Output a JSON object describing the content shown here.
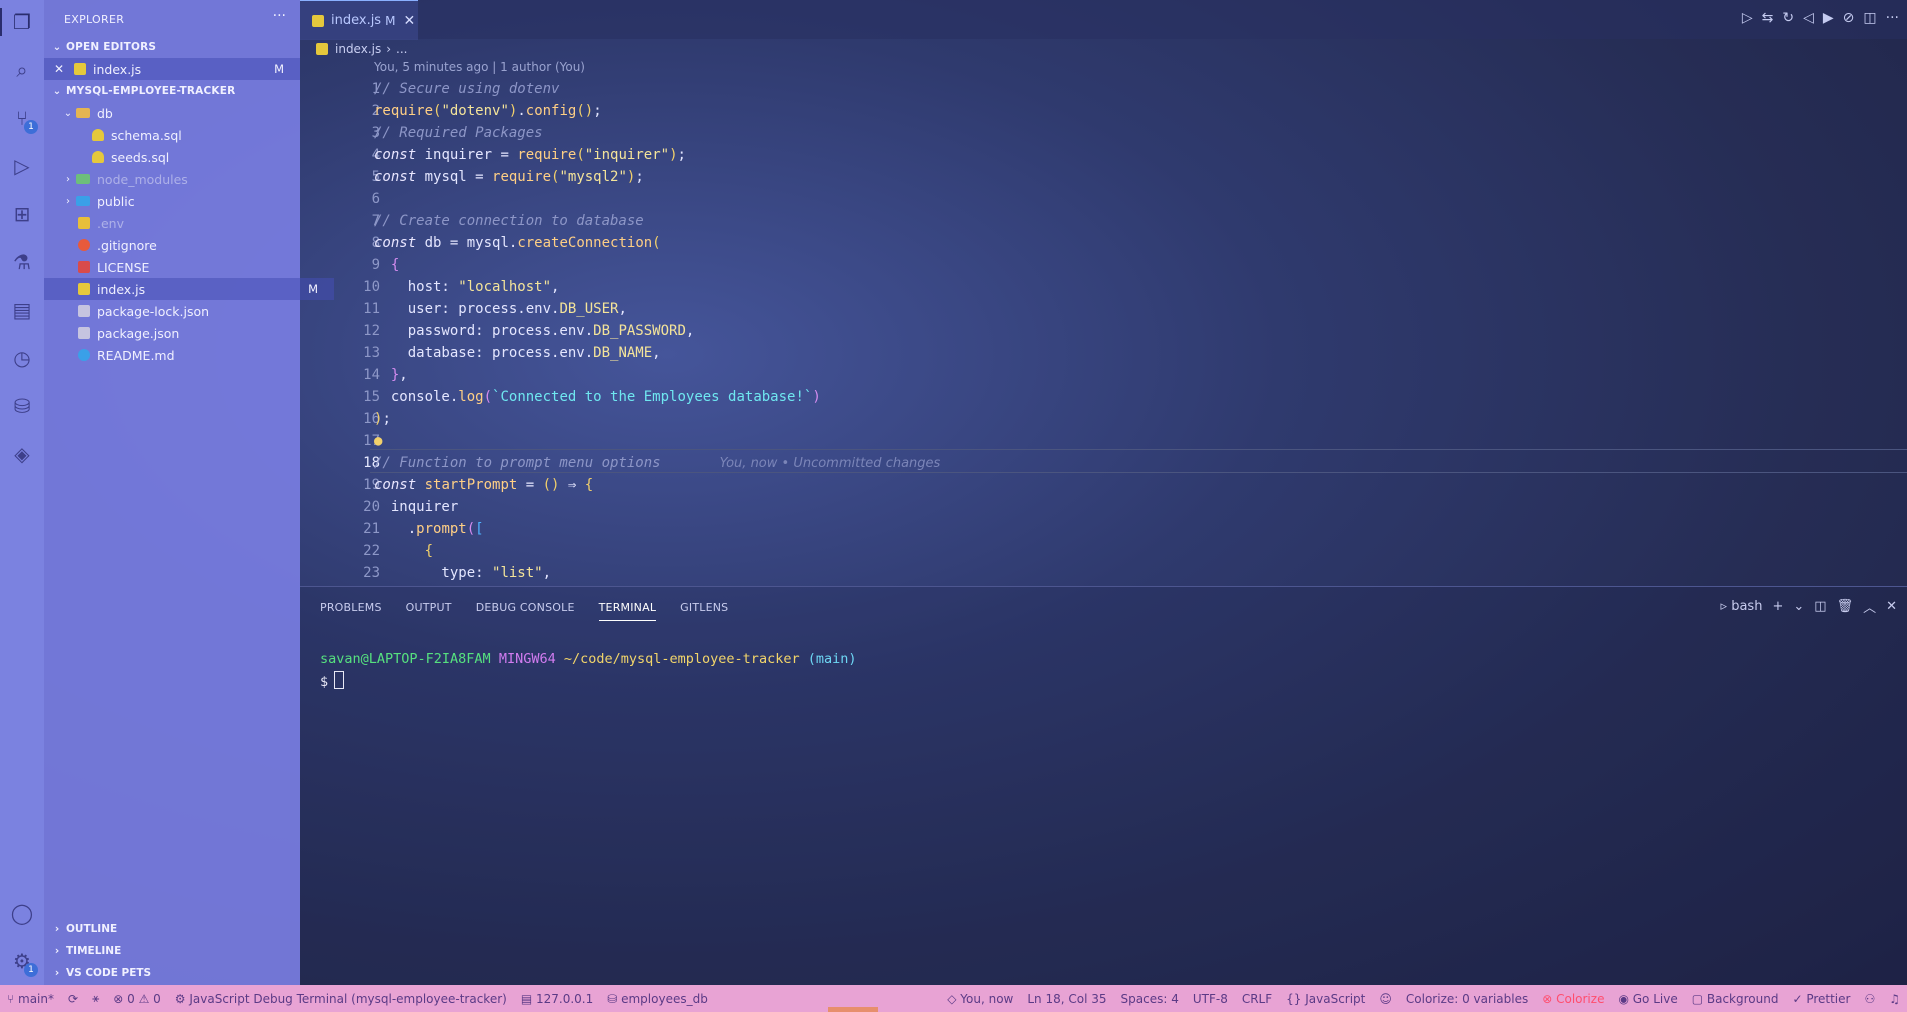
{
  "activity_bar": {
    "items": [
      {
        "name": "files-icon",
        "glyph": "❐"
      },
      {
        "name": "search-icon",
        "glyph": "⌕"
      },
      {
        "name": "source-control-icon",
        "glyph": "⑂",
        "badge": "1"
      },
      {
        "name": "run-debug-icon",
        "glyph": "▷"
      },
      {
        "name": "extensions-icon",
        "glyph": "⊞"
      },
      {
        "name": "testing-icon",
        "glyph": "⚗"
      },
      {
        "name": "notebook-icon",
        "glyph": "▤"
      },
      {
        "name": "git-graph-icon",
        "glyph": "◷"
      },
      {
        "name": "database-icon",
        "glyph": "⛁"
      },
      {
        "name": "layers-icon",
        "glyph": "◈"
      }
    ],
    "account_glyph": "◯",
    "settings_glyph": "⚙",
    "settings_badge": "1"
  },
  "sidebar": {
    "title": "EXPLORER",
    "more": "···",
    "open_editors": {
      "header": "OPEN EDITORS",
      "items": [
        {
          "close": "✕",
          "label": "index.js",
          "mark": "M"
        }
      ]
    },
    "project": {
      "header": "MYSQL-EMPLOYEE-TRACKER",
      "tree": [
        {
          "label": "db",
          "kind": "folder",
          "chevron": "⌄"
        },
        {
          "label": "schema.sql",
          "kind": "sql"
        },
        {
          "label": "seeds.sql",
          "kind": "sql"
        },
        {
          "label": "node_modules",
          "kind": "folder-g",
          "chevron": "›"
        },
        {
          "label": "public",
          "kind": "folder-b",
          "chevron": "›"
        },
        {
          "label": ".env",
          "kind": "env"
        },
        {
          "label": ".gitignore",
          "kind": "git"
        },
        {
          "label": "LICENSE",
          "kind": "lic"
        },
        {
          "label": "index.js",
          "kind": "js",
          "mark": "M"
        },
        {
          "label": "package-lock.json",
          "kind": "json"
        },
        {
          "label": "package.json",
          "kind": "json"
        },
        {
          "label": "README.md",
          "kind": "info"
        }
      ]
    },
    "bottom_sections": [
      "OUTLINE",
      "TIMELINE",
      "VS CODE PETS"
    ]
  },
  "editor": {
    "tab": {
      "label": "index.js",
      "mark": "M",
      "close": "✕"
    },
    "toolbar_glyphs": [
      "▷",
      "⇆",
      "↻",
      "◁",
      "▶",
      "⊘",
      "◫",
      "···"
    ],
    "breadcrumb": {
      "file": "index.js",
      "sep": "›",
      "rest": "..."
    },
    "blame_header": "You, 5 minutes ago | 1 author (You)",
    "current_line": 18,
    "ghost_text": "You, now • Uncommitted changes",
    "line_numbers": [
      "1",
      "2",
      "3",
      "4",
      "5",
      "6",
      "7",
      "8",
      "9",
      "10",
      "11",
      "12",
      "13",
      "14",
      "15",
      "16",
      "17",
      "18",
      "19",
      "20",
      "21",
      "22",
      "23"
    ]
  },
  "panel": {
    "tabs": [
      "PROBLEMS",
      "OUTPUT",
      "DEBUG CONSOLE",
      "TERMINAL",
      "GITLENS"
    ],
    "active_tab": "TERMINAL",
    "terminal_name": "bash",
    "actions": [
      "+",
      "⌄",
      "◫",
      "🗑",
      "︿",
      "✕"
    ],
    "prompt": {
      "user_host": "savan@LAPTOP-F2IA8FAM",
      "shell": "MINGW64",
      "path": "~/code/mysql-employee-tracker",
      "branch": "(main)",
      "dollar": "$"
    }
  },
  "statusbar": {
    "left": [
      {
        "name": "branch",
        "text": "⑂ main*"
      },
      {
        "name": "sync",
        "text": "⟳"
      },
      {
        "name": "publish",
        "text": "⚹"
      },
      {
        "name": "problems",
        "text": "⊗ 0 ⚠ 0"
      },
      {
        "name": "debug-terminal",
        "text": "⚙ JavaScript Debug Terminal (mysql-employee-tracker)"
      },
      {
        "name": "db-host",
        "text": "▤ 127.0.0.1"
      },
      {
        "name": "db-name",
        "text": "⛁ employees_db"
      }
    ],
    "right": [
      {
        "name": "blame",
        "text": "◇ You, now"
      },
      {
        "name": "cursor-position",
        "text": "Ln 18, Col 35"
      },
      {
        "name": "indent",
        "text": "Spaces: 4"
      },
      {
        "name": "encoding",
        "text": "UTF-8"
      },
      {
        "name": "eol",
        "text": "CRLF"
      },
      {
        "name": "language",
        "text": "{} JavaScript"
      },
      {
        "name": "feedback",
        "text": "☺"
      },
      {
        "name": "colorize",
        "text": "Colorize: 0 variables"
      },
      {
        "name": "colorize-action",
        "text": "⊗ Colorize",
        "red": true
      },
      {
        "name": "go-live",
        "text": "◉ Go Live"
      },
      {
        "name": "background",
        "text": "▢ Background"
      },
      {
        "name": "prettier",
        "text": "✓ Prettier"
      },
      {
        "name": "accounts",
        "text": "⚇"
      },
      {
        "name": "notifications",
        "text": "♫"
      }
    ]
  }
}
